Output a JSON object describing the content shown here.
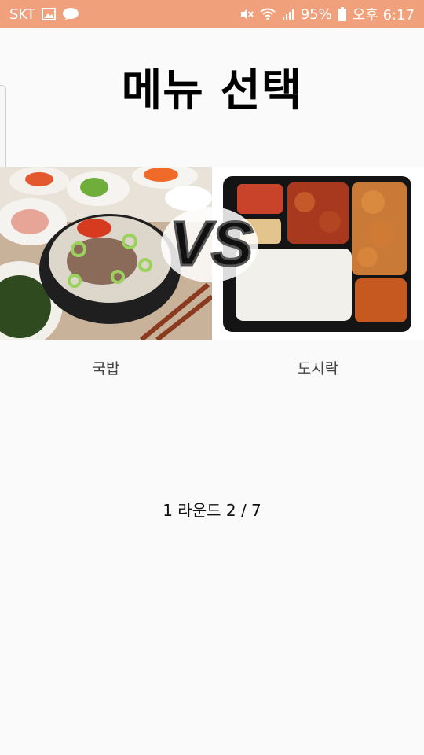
{
  "status_bar": {
    "carrier": "SKT",
    "battery": "95%",
    "time": "오후 6:17",
    "icons": [
      "gallery-icon",
      "talk-icon",
      "mute-icon",
      "wifi-icon",
      "signal-icon",
      "battery-icon"
    ]
  },
  "title": "메뉴 선택",
  "choices": [
    {
      "label": "국밥",
      "image": "gukbap-photo"
    },
    {
      "label": "도시락",
      "image": "dosirak-photo"
    }
  ],
  "vs_label": "VS",
  "round_text": "1 라운드 2 / 7",
  "colors": {
    "status_bar": "#f0a07a",
    "background": "#fafafa"
  }
}
